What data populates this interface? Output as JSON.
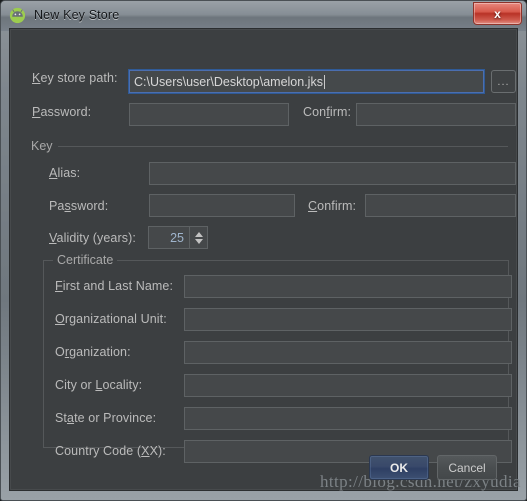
{
  "window": {
    "title": "New Key Store",
    "app_icon": "android-studio-icon",
    "close_label": "x"
  },
  "form": {
    "keystore_path": {
      "label_prefix": "",
      "label_mnemonic": "K",
      "label_suffix": "ey store path:",
      "value": "C:\\Users\\user\\Desktop\\amelon.jks",
      "focused": true
    },
    "browse_label": "...",
    "password": {
      "label_prefix": "",
      "label_mnemonic": "P",
      "label_suffix": "assword:",
      "value": ""
    },
    "confirm": {
      "label_prefix": "Con",
      "label_mnemonic": "f",
      "label_suffix": "irm:",
      "value": ""
    }
  },
  "key_group": {
    "title": "Key",
    "alias": {
      "label_prefix": "",
      "label_mnemonic": "A",
      "label_suffix": "lias:",
      "value": ""
    },
    "password": {
      "label_prefix": "Pa",
      "label_mnemonic": "s",
      "label_suffix": "sword:",
      "value": ""
    },
    "confirm": {
      "label_prefix": "",
      "label_mnemonic": "C",
      "label_suffix": "onfirm:",
      "value": ""
    },
    "validity": {
      "label_prefix": "",
      "label_mnemonic": "V",
      "label_suffix": "alidity (years):",
      "value": "25"
    }
  },
  "certificate_group": {
    "title": "Certificate",
    "fields": [
      {
        "name": "first-and-last-name",
        "label_prefix": "",
        "label_mnemonic": "F",
        "label_suffix": "irst and Last Name:",
        "value": ""
      },
      {
        "name": "organizational-unit",
        "label_prefix": "",
        "label_mnemonic": "O",
        "label_suffix": "rganizational Unit:",
        "value": ""
      },
      {
        "name": "organization",
        "label_prefix": "O",
        "label_mnemonic": "r",
        "label_suffix": "ganization:",
        "value": ""
      },
      {
        "name": "city-or-locality",
        "label_prefix": "City or ",
        "label_mnemonic": "L",
        "label_suffix": "ocality:",
        "value": ""
      },
      {
        "name": "state-or-province",
        "label_prefix": "St",
        "label_mnemonic": "a",
        "label_suffix": "te or Province:",
        "value": ""
      },
      {
        "name": "country-code",
        "label_prefix": "Country Code (",
        "label_mnemonic": "X",
        "label_suffix": "X):",
        "value": ""
      }
    ]
  },
  "buttons": {
    "ok": "OK",
    "cancel": "Cancel"
  },
  "watermark": "http://blog.csdn.net/zxyudia",
  "colors": {
    "dialog_background": "#3c3f41",
    "field_background": "#45484a",
    "field_border": "#5e6264",
    "label_text": "#bbbbbb",
    "focus_border": "#4b6eaf",
    "ok_button": "#39496a",
    "close_button": "#b83226",
    "spinner_value": "#9fb4cc"
  }
}
